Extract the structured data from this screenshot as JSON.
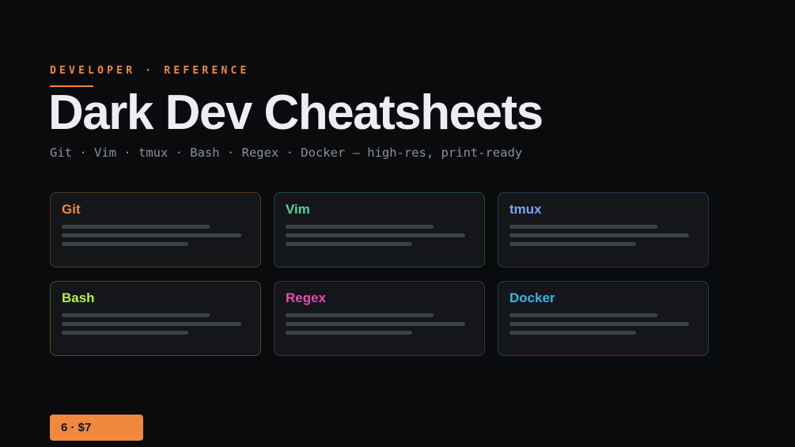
{
  "header": {
    "eyebrow": "DEVELOPER · REFERENCE",
    "title": "Dark Dev Cheatsheets",
    "subtitle": "Git · Vim · tmux · Bash · Regex · Docker — high-res, print-ready"
  },
  "cards": [
    {
      "title": "Git",
      "accent": "#f0883e",
      "border": "#5b3a24"
    },
    {
      "title": "Vim",
      "accent": "#4fd69c",
      "border": "#1f4a3c"
    },
    {
      "title": "tmux",
      "accent": "#7aa2f7",
      "border": "#2a3550"
    },
    {
      "title": "Bash",
      "accent": "#b8f03c",
      "border": "#44521e"
    },
    {
      "title": "Regex",
      "accent": "#e64bb0",
      "border": "#502545"
    },
    {
      "title": "Docker",
      "accent": "#2fb6e6",
      "border": "#1a4250"
    }
  ],
  "price_badge": {
    "label": "6 · $7",
    "color": "#f0883e"
  }
}
